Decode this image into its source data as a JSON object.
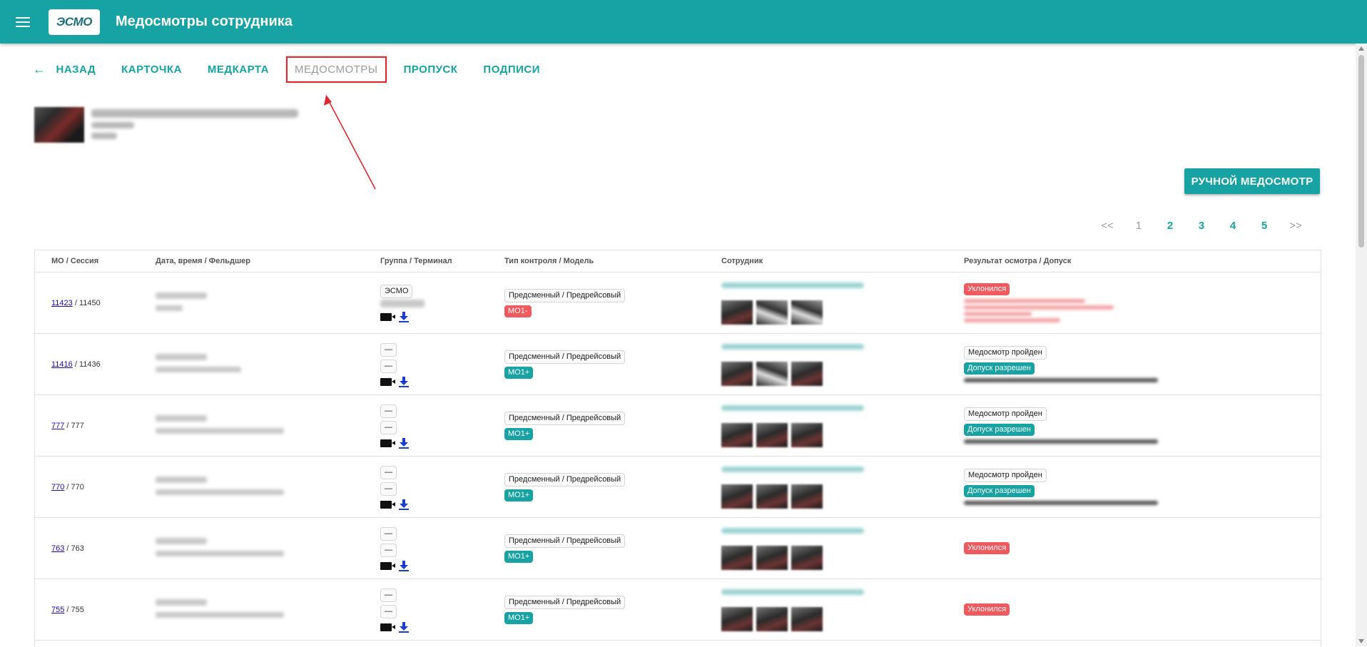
{
  "app": {
    "logo_text": "ЭСМО",
    "title": "Медосмотры сотрудника"
  },
  "nav": {
    "back": "НАЗАД",
    "tabs": [
      "КАРТОЧКА",
      "МЕДКАРТА",
      "МЕДОСМОТРЫ",
      "ПРОПУСК",
      "ПОДПИСИ"
    ],
    "active_tab": "МЕДОСМОТРЫ"
  },
  "manual_button": "РУЧНОЙ МЕДОСМОТР",
  "pagination": {
    "first": "<<",
    "pages": [
      "1",
      "2",
      "3",
      "4",
      "5"
    ],
    "current": "1",
    "last": ">>"
  },
  "table": {
    "headers": [
      "МО / Сессия",
      "Дата, время / Фельдшер",
      "Группа / Терминал",
      "Тип контроля / Модель",
      "Сотрудник",
      "Результат осмотра / Допуск"
    ],
    "rows": [
      {
        "mo": "11423",
        "session": " / 11450",
        "group": "ЭСМО",
        "group2": "",
        "type": "Предсменный / Предрейсовый",
        "model": "МО1-",
        "model_color": "red",
        "result": "Уклонился",
        "result_kind": "declined",
        "permit": ""
      },
      {
        "mo": "11416",
        "session": " / 11436",
        "group": "—",
        "group2": "—",
        "type": "Предсменный / Предрейсовый",
        "model": "МО1+",
        "model_color": "teal",
        "result": "Медосмотр пройден",
        "result_kind": "passed",
        "permit": "Допуск разрешен"
      },
      {
        "mo": "777",
        "session": " / 777",
        "group": "—",
        "group2": "—",
        "type": "Предсменный / Предрейсовый",
        "model": "МО1+",
        "model_color": "teal",
        "result": "Медосмотр пройден",
        "result_kind": "passed",
        "permit": "Допуск разрешен"
      },
      {
        "mo": "770",
        "session": " / 770",
        "group": "—",
        "group2": "—",
        "type": "Предсменный / Предрейсовый",
        "model": "МО1+",
        "model_color": "teal",
        "result": "Медосмотр пройден",
        "result_kind": "passed",
        "permit": "Допуск разрешен"
      },
      {
        "mo": "763",
        "session": " / 763",
        "group": "—",
        "group2": "—",
        "type": "Предсменный / Предрейсовый",
        "model": "МО1+",
        "model_color": "teal",
        "result": "Уклонился",
        "result_kind": "declined",
        "permit": ""
      },
      {
        "mo": "755",
        "session": " / 755",
        "group": "—",
        "group2": "—",
        "type": "Предсменный / Предрейсовый",
        "model": "МО1+",
        "model_color": "teal",
        "result": "Уклонился",
        "result_kind": "declined",
        "permit": ""
      }
    ]
  },
  "colors": {
    "accent": "#17a2a4",
    "danger": "#f05a5e",
    "link": "#1a0dab",
    "annotation": "#e0262f"
  }
}
